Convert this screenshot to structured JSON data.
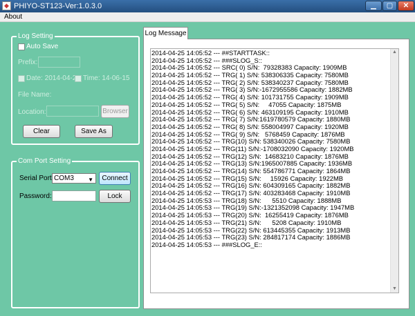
{
  "window": {
    "title": "PHIYO-ST123-Ver:1.0.3.0"
  },
  "menu": {
    "about": "About"
  },
  "log_setting": {
    "legend": "Log Setting",
    "auto_save": "Auto Save",
    "prefix_label": "Prefix:",
    "date_label": "Date: 2014-04-25",
    "time_label": "Time: 14-06-15",
    "file_name_label": "File Name:",
    "location_label": "Location:",
    "browse": "Browser",
    "clear": "Clear",
    "save_as": "Save As"
  },
  "com_port": {
    "legend": "Com Port Setting",
    "serial_port_label": "Serial Port:",
    "serial_port_value": "COM3",
    "connect": "Connect",
    "password_label": "Password:",
    "lock": "Lock"
  },
  "log_message": {
    "tab": "Log Message",
    "lines": [
      "2014-04-25 14:05:52 --- ##STARTTASK::",
      "2014-04-25 14:05:52 --- ###SLOG_S::",
      "2014-04-25 14:05:52 --- SRC( 0) S/N:  79328383 Capacity: 1909MB",
      "2014-04-25 14:05:52 --- TRG( 1) S/N: 538306335 Capacity: 7580MB",
      "2014-04-25 14:05:52 --- TRG( 2) S/N: 538340237 Capacity: 7580MB",
      "2014-04-25 14:05:52 --- TRG( 3) S/N:-1672955586 Capacity: 1882MB",
      "2014-04-25 14:05:52 --- TRG( 4) S/N: 101731755 Capacity: 1909MB",
      "2014-04-25 14:05:52 --- TRG( 5) S/N:     47055 Capacity: 1875MB",
      "2014-04-25 14:05:52 --- TRG( 6) S/N: 463109195 Capacity: 1910MB",
      "2014-04-25 14:05:52 --- TRG( 7) S/N:1619780579 Capacity: 1880MB",
      "2014-04-25 14:05:52 --- TRG( 8) S/N: 558004997 Capacity: 1920MB",
      "2014-04-25 14:05:52 --- TRG( 9) S/N:   5768459 Capacity: 1876MB",
      "2014-04-25 14:05:52 --- TRG(10) S/N: 538340026 Capacity: 7580MB",
      "2014-04-25 14:05:52 --- TRG(11) S/N:-1708032090 Capacity: 1920MB",
      "2014-04-25 14:05:52 --- TRG(12) S/N:  14683210 Capacity: 1876MB",
      "2014-04-25 14:05:52 --- TRG(13) S/N:1965007885 Capacity: 1936MB",
      "2014-04-25 14:05:52 --- TRG(14) S/N: 554786771 Capacity: 1864MB",
      "2014-04-25 14:05:52 --- TRG(15) S/N:     15926 Capacity: 1922MB",
      "2014-04-25 14:05:52 --- TRG(16) S/N: 604309165 Capacity: 1882MB",
      "2014-04-25 14:05:52 --- TRG(17) S/N: 403283468 Capacity: 1910MB",
      "2014-04-25 14:05:53 --- TRG(18) S/N:      5510 Capacity: 1888MB",
      "2014-04-25 14:05:53 --- TRG(19) S/N:-1321352098 Capacity: 1947MB",
      "2014-04-25 14:05:53 --- TRG(20) S/N:  16255419 Capacity: 1876MB",
      "2014-04-25 14:05:53 --- TRG(21) S/N:      5208 Capacity: 1910MB",
      "2014-04-25 14:05:53 --- TRG(22) S/N: 613445355 Capacity: 1913MB",
      "2014-04-25 14:05:53 --- TRG(23) S/N: 284817174 Capacity: 1886MB",
      "2014-04-25 14:05:53 --- ###SLOG_E::"
    ]
  },
  "icons": {
    "app": "app-icon",
    "minimize": "minimize-icon",
    "maximize": "maximize-icon",
    "close": "close-icon",
    "dropdown": "chevron-down-icon"
  },
  "colors": {
    "background": "#6ec7a6",
    "titlebar": "#2d5f95",
    "close_button": "#c23a1f"
  }
}
